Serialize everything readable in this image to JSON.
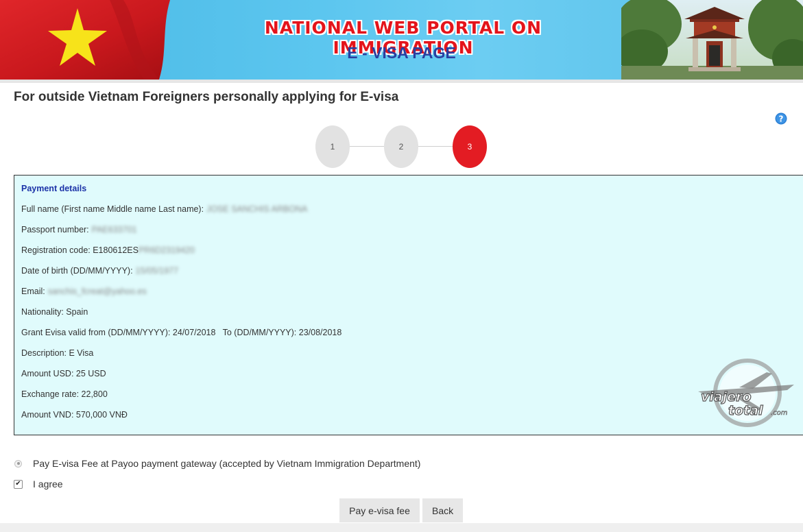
{
  "banner": {
    "title": "NATIONAL WEB PORTAL ON IMMIGRATION",
    "subtitle": "E - VISA PAGE"
  },
  "page": {
    "title": "For outside Vietnam Foreigners personally applying for E-visa",
    "help_icon": "question-circle-icon"
  },
  "stepper": {
    "steps": [
      "1",
      "2",
      "3"
    ],
    "active_step": "3"
  },
  "payment": {
    "title": "Payment details",
    "full_name_label": "Full name (First name Middle name Last name):",
    "full_name_value": "JOSE SANCHIS ARBONA",
    "passport_label": "Passport number:",
    "passport_value": "PAE633701",
    "registration_label": "Registration code: E180612ES",
    "registration_value": "PR6D2319420",
    "dob_label": "Date of birth (DD/MM/YYYY):",
    "dob_value": "15/05/1977",
    "email_label": "Email:",
    "email_value": "sanchis_fcreat@yahoo.es",
    "nationality": "Nationality: Spain",
    "grant": "Grant Evisa valid from (DD/MM/YYYY): 24/07/2018   To (DD/MM/YYYY): 23/08/2018",
    "description": "Description: E Visa",
    "amount_usd": "Amount USD: 25 USD",
    "exchange_rate": "Exchange rate: 22,800",
    "amount_vnd": "Amount VND: 570,000 VNĐ"
  },
  "watermark": {
    "line1": "viajero",
    "line2": "total",
    "suffix": ".com"
  },
  "options": {
    "pay_gateway": "Pay E-visa Fee at Payoo payment gateway (accepted by Vietnam Immigration Department)",
    "agree": "I agree",
    "agree_checked": true
  },
  "buttons": {
    "pay": "Pay e-visa fee",
    "back": "Back"
  },
  "colors": {
    "banner_blue": "#5cc6ef",
    "title_red": "#e4141b",
    "subtitle_blue": "#2a3fa0",
    "active_step_red": "#e31c23",
    "panel_bg": "#e0fbfc",
    "panel_title_blue": "#1c33a8"
  }
}
